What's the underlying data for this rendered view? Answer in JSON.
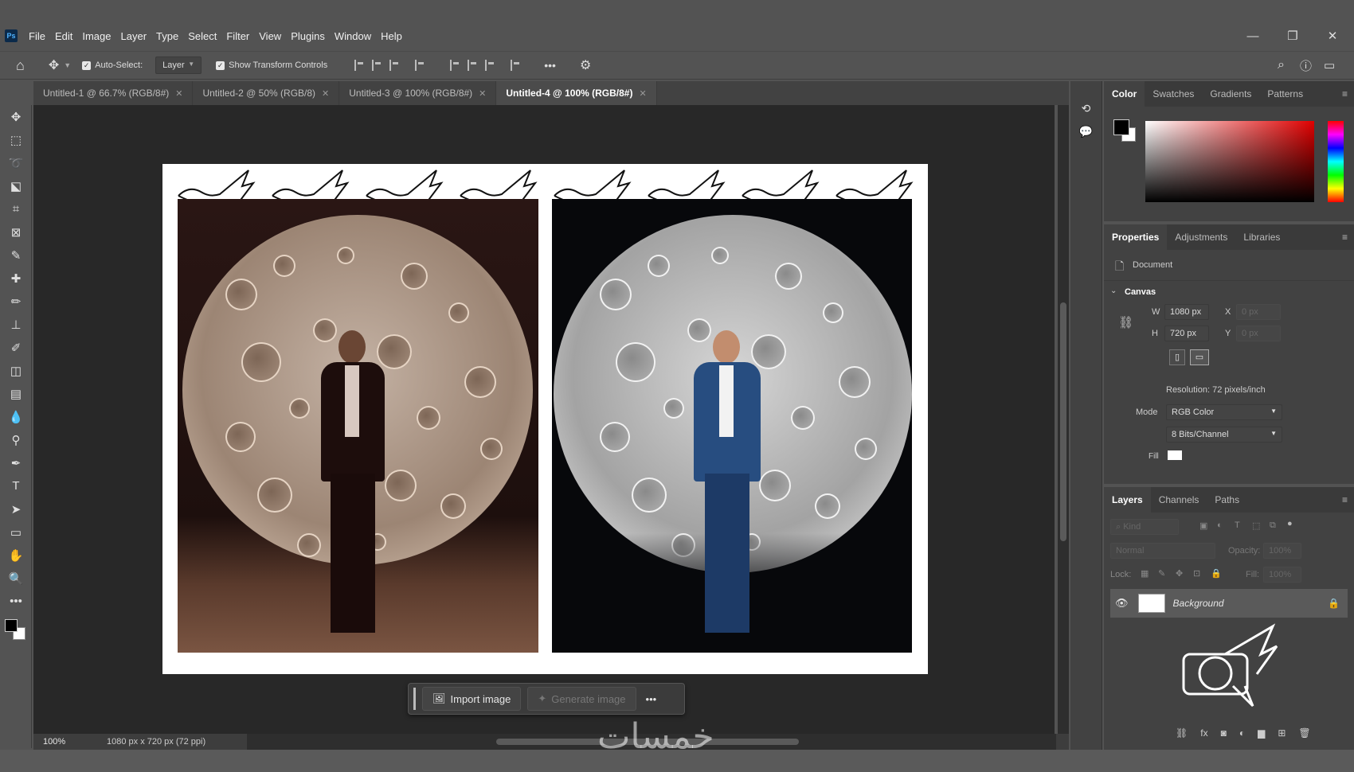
{
  "app": {
    "logo": "Ps"
  },
  "menu": [
    "File",
    "Edit",
    "Image",
    "Layer",
    "Type",
    "Select",
    "Filter",
    "View",
    "Plugins",
    "Window",
    "Help"
  ],
  "window_controls": {
    "minimize": "—",
    "restore": "❐",
    "close": "✕"
  },
  "options_bar": {
    "auto_select_label": "Auto-Select:",
    "auto_select_target": "Layer",
    "show_transform_label": "Show Transform Controls",
    "more": "•••"
  },
  "tabs": [
    {
      "label": "Untitled-1 @ 66.7% (RGB/8#)"
    },
    {
      "label": "Untitled-2 @ 50% (RGB/8)"
    },
    {
      "label": "Untitled-3 @ 100% (RGB/8#)"
    },
    {
      "label": "Untitled-4 @ 100% (RGB/8#)"
    }
  ],
  "tab_close": "✕",
  "tools": [
    "move-tool",
    "marquee-tool",
    "lasso-tool",
    "object-select-tool",
    "crop-tool",
    "frame-tool",
    "eyedropper-tool",
    "healing-tool",
    "brush-tool",
    "stamp-tool",
    "history-brush-tool",
    "eraser-tool",
    "gradient-tool",
    "blur-tool",
    "dodge-tool",
    "pen-tool",
    "type-tool",
    "path-select-tool",
    "rectangle-tool",
    "hand-tool",
    "zoom-tool",
    "more-tools"
  ],
  "tool_glyphs": [
    "✥",
    "⬚",
    "➰",
    "⬕",
    "⌗",
    "⊠",
    "✎",
    "✚",
    "✏",
    "⊥",
    "✐",
    "◫",
    "▤",
    "💧",
    "⚲",
    "✒",
    "T",
    "➤",
    "▭",
    "✋",
    "🔍",
    "•••"
  ],
  "context_bar": {
    "import_label": "Import image",
    "generate_label": "Generate image",
    "more": "•••"
  },
  "status": {
    "zoom": "100%",
    "doc_info": "1080 px x 720 px (72 ppi)"
  },
  "color_panel": {
    "tabs": [
      "Color",
      "Swatches",
      "Gradients",
      "Patterns"
    ]
  },
  "properties_panel": {
    "tabs": [
      "Properties",
      "Adjustments",
      "Libraries"
    ],
    "document_label": "Document",
    "canvas_label": "Canvas",
    "w_label": "W",
    "w_value": "1080 px",
    "h_label": "H",
    "h_value": "720 px",
    "x_label": "X",
    "x_value": "0 px",
    "y_label": "Y",
    "y_value": "0 px",
    "resolution": "Resolution: 72 pixels/inch",
    "mode_label": "Mode",
    "mode_value": "RGB Color",
    "depth_value": "8 Bits/Channel",
    "fill_label": "Fill"
  },
  "layers_panel": {
    "tabs": [
      "Layers",
      "Channels",
      "Paths"
    ],
    "kind_label": "Kind",
    "blend_mode": "Normal",
    "opacity_label": "Opacity:",
    "opacity_value": "100%",
    "lock_label": "Lock:",
    "fill_label": "Fill:",
    "fill_value": "100%",
    "layer_name": "Background"
  },
  "watermark": "خمسات",
  "colors": {
    "fg": "#000000",
    "bg": "#ffffff",
    "accent": "#4a9eff"
  }
}
